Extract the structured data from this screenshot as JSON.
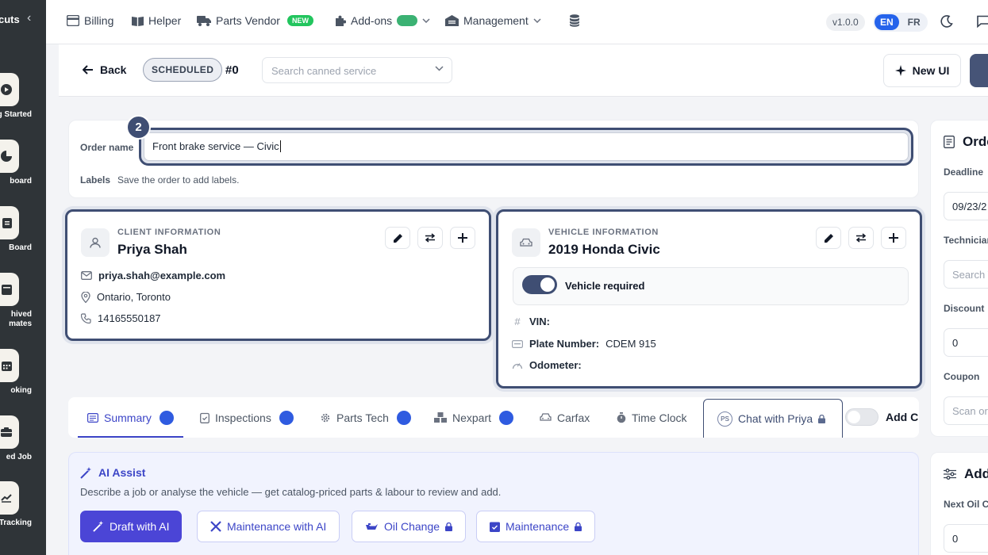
{
  "sidebar": {
    "title": "cuts",
    "items": [
      {
        "label": "g Started",
        "icon": "play-icon"
      },
      {
        "label": "board",
        "icon": "pie-chart-icon"
      },
      {
        "label": "Board",
        "icon": "clipboard-icon"
      },
      {
        "label": "hived\nmates",
        "icon": "archive-icon"
      },
      {
        "label": "oking",
        "icon": "calendar-icon"
      },
      {
        "label": "ed Job",
        "icon": "briefcase-icon"
      },
      {
        "label": "Tracking",
        "icon": "trend-chart-icon"
      }
    ]
  },
  "topnav": {
    "billing": "Billing",
    "helper": "Helper",
    "parts_vendor": "Parts Vendor",
    "new_badge": "NEW",
    "addons": "Add-ons",
    "management": "Management",
    "version": "v1.0.0",
    "lang_en": "EN",
    "lang_fr": "FR"
  },
  "toolbar": {
    "back": "Back",
    "status": "SCHEDULED",
    "order_number": "#0",
    "canned_placeholder": "Search canned service",
    "new_ui": "New UI"
  },
  "order": {
    "name_label": "Order name",
    "name_value": "Front brake service — Civic",
    "labels_label": "Labels",
    "labels_text": "Save the order to add labels.",
    "step": "2"
  },
  "client": {
    "category": "CLIENT INFORMATION",
    "name": "Priya Shah",
    "email": "priya.shah@example.com",
    "location": "Ontario, Toronto",
    "phone": "14165550187"
  },
  "vehicle": {
    "category": "VEHICLE INFORMATION",
    "name": "2019 Honda Civic",
    "toggle_label": "Vehicle required",
    "vin_label": "VIN:",
    "vin_value": "",
    "plate_label": "Plate Number:",
    "plate_value": "CDEM 915",
    "odometer_label": "Odometer:",
    "odometer_value": ""
  },
  "tabs": {
    "summary": "Summary",
    "inspections": "Inspections",
    "parts_tech": "Parts Tech",
    "nexpart": "Nexpart",
    "carfax": "Carfax",
    "time_clock": "Time Clock",
    "chat": "Chat with Priya",
    "chat_initials": "PS",
    "add": "Add C"
  },
  "ai": {
    "title": "AI Assist",
    "description": "Describe a job or analyse the vehicle — get catalog-priced parts & labour to review and add.",
    "draft": "Draft with AI",
    "maintenance_ai": "Maintenance with AI",
    "oil_change": "Oil Change",
    "maintenance": "Maintenance"
  },
  "right_panel": {
    "order_title": "Orde",
    "deadline_label": "Deadline",
    "deadline_value": "09/23/2",
    "technician_label": "Technician",
    "technician_placeholder": "Search T",
    "discount_label": "Discount",
    "discount_value": "0",
    "coupon_label": "Coupon",
    "coupon_placeholder": "Scan or",
    "add_title": "Add",
    "next_oil_label": "Next Oil C",
    "next_oil_value": "0"
  },
  "colors": {
    "accent": "#3c45c7",
    "primary_button": "#4b45d6",
    "focus_border": "#3f4e73",
    "sidebar_bg": "#2f3438",
    "new_badge": "#22c55e"
  }
}
